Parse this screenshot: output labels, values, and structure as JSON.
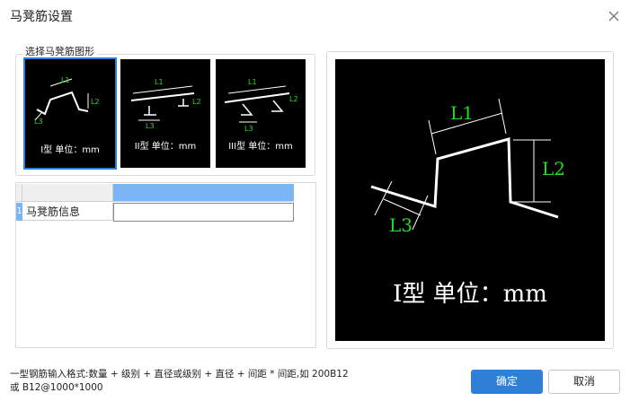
{
  "window": {
    "title": "马凳筋设置",
    "close_icon": "close-icon"
  },
  "shape_group": {
    "label": "选择马凳筋图形",
    "shapes": [
      {
        "caption": "I型 单位：mm",
        "labels": [
          "L1",
          "L2",
          "L3"
        ],
        "selected": true
      },
      {
        "caption": "II型 单位：mm",
        "labels": [
          "L1",
          "L2",
          "L3"
        ],
        "selected": false
      },
      {
        "caption": "III型 单位：mm",
        "labels": [
          "L1",
          "L2",
          "L3"
        ],
        "selected": false
      }
    ]
  },
  "grid": {
    "row_number": "1",
    "row_label": "马凳筋信息",
    "row_value": ""
  },
  "preview": {
    "caption": "I型 单位：mm",
    "labels": {
      "l1": "L1",
      "l2": "L2",
      "l3": "L3"
    }
  },
  "hint": {
    "line1": "一型钢筋输入格式:数量 + 级别 + 直径或级别 + 直径 + 间距 * 间距,如 200B12",
    "line2": "或 B12@1000*1000"
  },
  "buttons": {
    "ok": "确定",
    "cancel": "取消"
  },
  "colors": {
    "accent": "#2f7fd6",
    "label_green": "#22dd22",
    "header_blue": "#7ab5f5"
  }
}
